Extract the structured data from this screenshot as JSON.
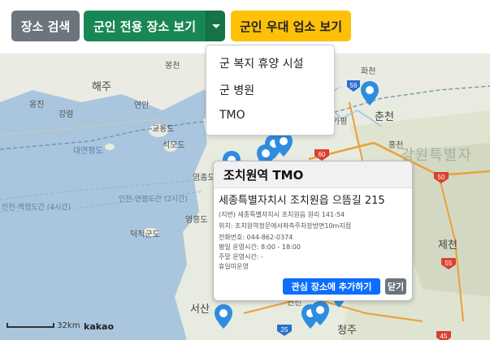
{
  "toolbar": {
    "search_label": "장소 검색",
    "military_places_label": "군인 전용 장소 보기",
    "discount_label": "군인 우대 업소 보기"
  },
  "dropdown": {
    "items": [
      "군 복지 휴양 시설",
      "군 병원",
      "TMO"
    ]
  },
  "popup": {
    "title": "조치원역 TMO",
    "address": "세종특별자치시 조치원읍 으뜸길 215",
    "jibun": "(지번) 세종특별자치시 조치원읍 원리 141-54",
    "location": "위치: 조치원역정문에서좌측주차장방면10m지점",
    "phone": "전화번호: 044-862-0374",
    "weekday_hours": "평일 운영시간: 8:00 - 18:00",
    "weekend_hours": "주말 운영시간: -",
    "holiday": "휴일미운영",
    "add_label": "관심 장소에 추가하기",
    "close_label": "닫기"
  },
  "map": {
    "labels": {
      "haeju": "해주",
      "bongcheon": "봉천",
      "ongjin": "옹진",
      "gangryeong": "강령",
      "yeonan": "연안",
      "gyodong": "교동도",
      "seongmo": "석모도",
      "daeyeonpyeong": "대연평도",
      "yeongjong": "영종도",
      "yeongheung": "영흥도",
      "deokjeok": "덕적군도",
      "hwacheon": "화천",
      "chuncheon": "춘천",
      "hongcheon": "홍천",
      "gangwon": "강원특별자",
      "jecheon": "제천",
      "cheongju": "청주",
      "seosan": "서산",
      "route1": "인천-백령도간 (4시간)",
      "route2": "인천-연평도간 (2시간)",
      "gapyeong": "가평",
      "jincheon": "진천"
    },
    "road_numbers": [
      "56",
      "60",
      "50",
      "55",
      "25",
      "45"
    ],
    "scale_label": "32km",
    "brand": "kakao"
  }
}
